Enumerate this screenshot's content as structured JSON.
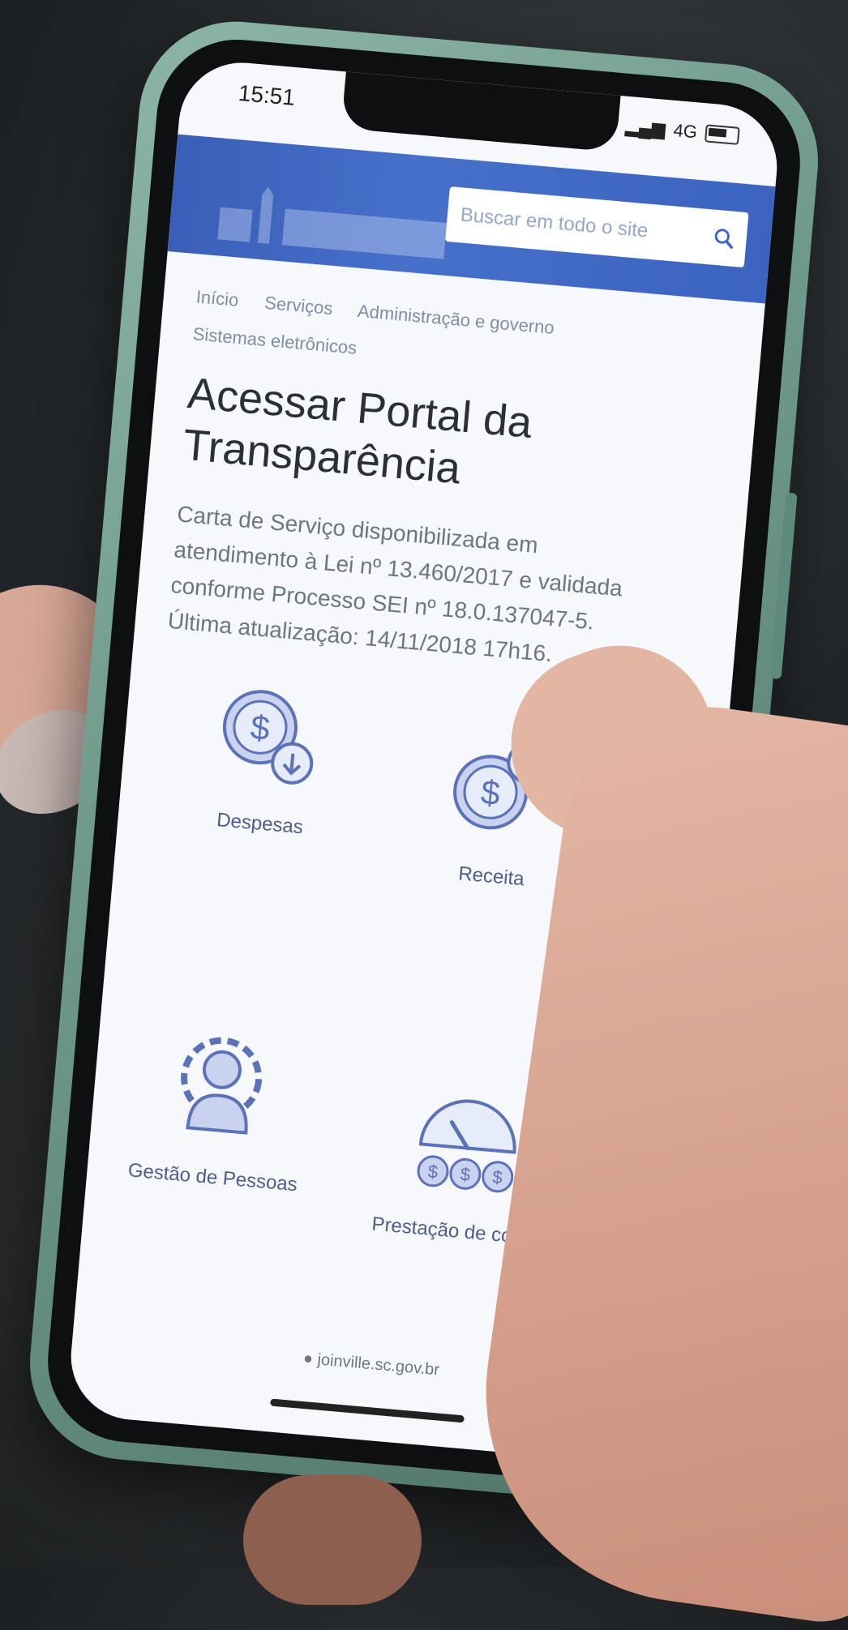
{
  "status_bar": {
    "time": "15:51",
    "network": "4G"
  },
  "search": {
    "placeholder": "Buscar em todo o site",
    "icon": "search-icon"
  },
  "breadcrumb": {
    "items": [
      "Início",
      "Serviços",
      "Administração e governo",
      "Sistemas eletrônicos"
    ]
  },
  "page": {
    "title": "Acessar Portal da Transparência",
    "description": "Carta de Serviço disponibilizada em atendimento à Lei nº 13.460/2017 e validada conforme Processo SEI nº 18.0.137047-5. Última atualização: 14/11/2018 17h16."
  },
  "tiles": [
    {
      "label": "Despesas",
      "icon": "coin-down-icon"
    },
    {
      "label": "Receita",
      "icon": "coin-up-icon"
    },
    {
      "label": "Gestão de Pessoas",
      "icon": "people-gear-icon"
    },
    {
      "label": "Prestação de contas",
      "icon": "gauge-coins-icon"
    }
  ],
  "footer": {
    "url": "joinville.sc.gov.br"
  },
  "colors": {
    "header_blue": "#3f66c2",
    "icon_blue": "#5b72b8",
    "icon_fill": "#c9d3ef",
    "phone_case": "#7ea899"
  }
}
